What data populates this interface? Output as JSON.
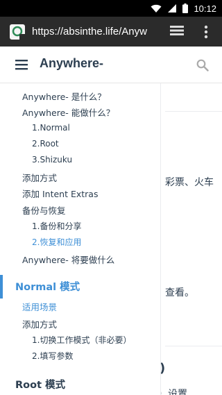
{
  "status_bar": {
    "time": "10:12"
  },
  "browser": {
    "url": "https://absinthe.life/Anyw"
  },
  "header": {
    "title": "Anywhere-"
  },
  "sidebar": {
    "items": [
      {
        "label": "Anywhere- 是什么？"
      },
      {
        "label": "Anywhere- 能做什么？"
      },
      {
        "label": "1.Normal"
      },
      {
        "label": "2.Root"
      },
      {
        "label": "3.Shizuku"
      },
      {
        "label": "添加方式"
      },
      {
        "label": "添加 Intent Extras"
      },
      {
        "label": "备份与恢复"
      },
      {
        "label": "1.备份和分享"
      },
      {
        "label": "2.恢复和应用"
      },
      {
        "label": "Anywhere- 将要做什么"
      }
    ],
    "normal_heading": "Normal 模式",
    "normal_items": [
      {
        "label": "适用场景"
      },
      {
        "label": "添加方式"
      },
      {
        "label": "1.切换工作模式（非必要）"
      },
      {
        "label": "2.填写参数"
      }
    ],
    "root_heading": "Root 模式"
  },
  "content_fragments": {
    "line1": "彩票、火车",
    "line2": "查看。",
    "line3": ")",
    "line4": "）设置"
  },
  "colors": {
    "accent": "#3e8fd6",
    "text": "#2c3e50",
    "status_bar": "#000000",
    "browser_bar": "#2b2b2b"
  }
}
